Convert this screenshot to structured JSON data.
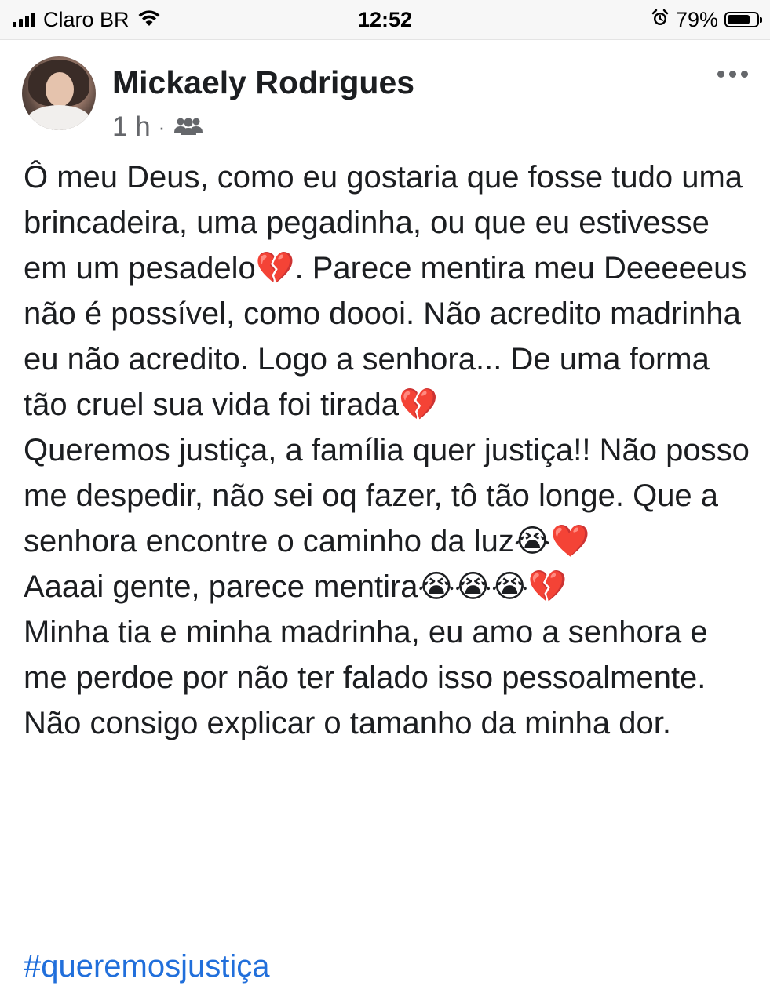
{
  "status_bar": {
    "carrier": "Claro BR",
    "time": "12:52",
    "battery_percent": "79%",
    "battery_level": 0.79,
    "icons": [
      "signal-icon",
      "wifi-icon",
      "alarm-icon",
      "battery-icon"
    ]
  },
  "post": {
    "author": "Mickaely Rodrigues",
    "time_ago": "1 h",
    "separator": "·",
    "audience_icon": "friends-icon",
    "paragraphs": [
      "Ô meu Deus, como eu gostaria que fosse tudo uma brincadeira, uma pegadinha, ou que eu estivesse em um pesadelo💔. Parece mentira meu Deeeeeus não é possível, como doooi. Não acredito madrinha eu não acredito. Logo a senhora... De uma forma tão cruel sua vida foi tirada💔\nQueremos justiça, a família quer justiça!! Não posso me despedir, não sei oq fazer, tô tão longe. Que a senhora encontre o caminho da luz😭❤️",
      "Aaaai gente, parece mentira😭😭😭💔\nMinha tia e minha madrinha, eu amo a senhora e me perdoe por não ter falado isso pessoalmente. Não consigo explicar o tamanho da minha dor."
    ],
    "hashtag": "#queremosjustiça"
  },
  "colors": {
    "text": "#1c1e21",
    "secondary": "#65676b",
    "link": "#216fdb",
    "status_bar_bg": "#f7f7f7"
  }
}
